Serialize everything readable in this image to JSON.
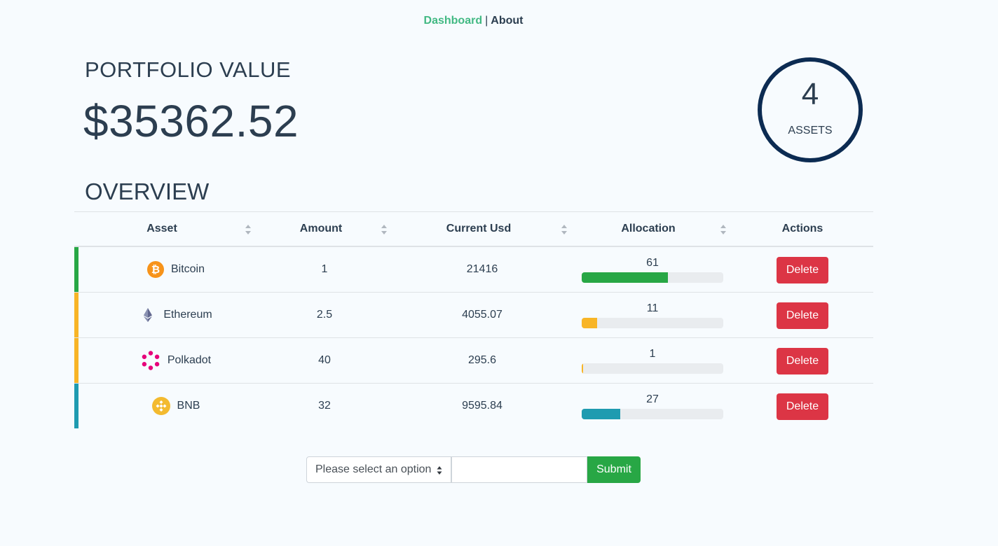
{
  "nav": {
    "active_link": "Dashboard",
    "separator": "|",
    "link": "About"
  },
  "portfolio": {
    "title": "PORTFOLIO VALUE",
    "value": "$35362.52"
  },
  "assets_summary": {
    "count": "4",
    "label": "ASSETS"
  },
  "overview": {
    "title": "OVERVIEW"
  },
  "table": {
    "headers": [
      "Asset",
      "Amount",
      "Current Usd",
      "Allocation",
      "Actions"
    ],
    "rows": [
      {
        "asset": "Bitcoin",
        "icon": "bitcoin-icon",
        "amount": "1",
        "current_usd": "21416",
        "allocation": "61",
        "allocation_fraction": 0.61,
        "color": "#28a745",
        "action": "Delete"
      },
      {
        "asset": "Ethereum",
        "icon": "ethereum-icon",
        "amount": "2.5",
        "current_usd": "4055.07",
        "allocation": "11",
        "allocation_fraction": 0.11,
        "color": "#f8b526",
        "action": "Delete"
      },
      {
        "asset": "Polkadot",
        "icon": "polkadot-icon",
        "amount": "40",
        "current_usd": "295.6",
        "allocation": "1",
        "allocation_fraction": 0.01,
        "color": "#f8b526",
        "action": "Delete"
      },
      {
        "asset": "BNB",
        "icon": "bnb-icon",
        "amount": "32",
        "current_usd": "9595.84",
        "allocation": "27",
        "allocation_fraction": 0.27,
        "color": "#1f9bb0",
        "action": "Delete"
      }
    ]
  },
  "form": {
    "select_value": "Please select an option",
    "input_value": "",
    "submit_label": "Submit"
  }
}
